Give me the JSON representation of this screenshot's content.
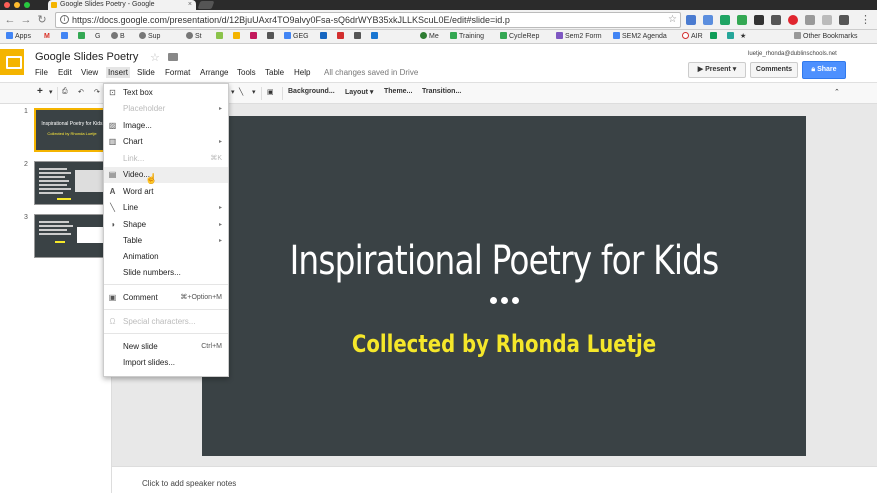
{
  "browser": {
    "tab_title": "Google Slides Poetry - Google",
    "url": "https://docs.google.com/presentation/d/12BjuUAxr4TO9alvy0Fsa-sQ6drWYB35xkJLLKScuL0E/edit#slide=id.p"
  },
  "bookmarks": {
    "items": [
      "Apps",
      "M",
      "",
      "G",
      "B",
      "Sup",
      "St",
      "",
      "",
      "",
      "",
      "GEG",
      "",
      "",
      "",
      "",
      "Me",
      "Training",
      "CycleRep",
      "Sem2 Form",
      "SEM2 Agenda",
      "AIR"
    ],
    "other": "Other Bookmarks"
  },
  "app": {
    "title": "Google Slides Poetry",
    "menus": [
      "File",
      "Edit",
      "View",
      "Insert",
      "Slide",
      "Format",
      "Arrange",
      "Tools",
      "Table",
      "Help"
    ],
    "saved_status": "All changes saved in Drive",
    "user_email": "luetje_rhonda@dublinschools.net",
    "present_label": "Present",
    "comments_label": "Comments",
    "share_label": "Share"
  },
  "toolbar": {
    "background": "Background...",
    "layout": "Layout",
    "theme": "Theme...",
    "transition": "Transition..."
  },
  "filmstrip": {
    "slides": [
      {
        "num": "1",
        "title": "Inspirational Poetry for Kids",
        "subtitle": "Collected by Rhonda Luetje"
      },
      {
        "num": "2"
      },
      {
        "num": "3"
      }
    ]
  },
  "slide": {
    "title": "Inspirational Poetry for Kids",
    "subtitle": "Collected by Rhonda Luetje",
    "bg_color": "#3a4245",
    "subtitle_color": "#f5e72a"
  },
  "notes": {
    "placeholder": "Click to add speaker notes"
  },
  "insert_menu": {
    "items": [
      {
        "label": "Text box",
        "icon": "text-box-icon"
      },
      {
        "label": "Placeholder",
        "disabled": true,
        "submenu": true
      },
      {
        "label": "Image...",
        "icon": "image-icon"
      },
      {
        "label": "Chart",
        "icon": "chart-icon",
        "submenu": true
      },
      {
        "label": "Link...",
        "disabled": true,
        "shortcut": "⌘K"
      },
      {
        "label": "Video...",
        "icon": "video-icon",
        "hover": true
      },
      {
        "label": "Word art",
        "icon": "word-art-icon"
      },
      {
        "label": "Line",
        "icon": "line-icon",
        "submenu": true
      },
      {
        "label": "Shape",
        "icon": "shape-icon",
        "submenu": true
      },
      {
        "label": "Table",
        "submenu": true
      },
      {
        "label": "Animation"
      },
      {
        "label": "Slide numbers..."
      },
      {
        "label": "Comment",
        "icon": "comment-icon",
        "shortcut": "⌘+Option+M"
      },
      {
        "label": "Special characters...",
        "disabled": true,
        "icon": "omega-icon"
      },
      {
        "label": "New slide",
        "shortcut": "Ctrl+M"
      },
      {
        "label": "Import slides..."
      }
    ]
  },
  "colors": {
    "accent": "#f4b400",
    "share_blue": "#4d90fe"
  }
}
